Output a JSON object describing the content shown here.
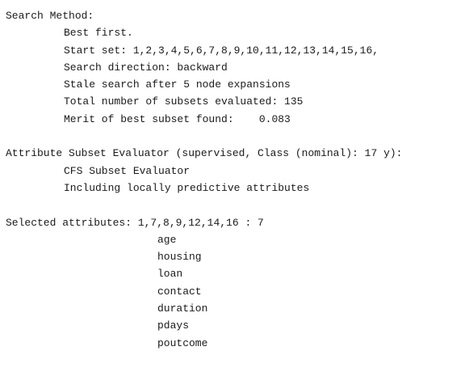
{
  "search": {
    "heading": "Search Method:",
    "method": "Best first.",
    "start_set": "Start set: 1,2,3,4,5,6,7,8,9,10,11,12,13,14,15,16,",
    "direction": "Search direction: backward",
    "stale": "Stale search after 5 node expansions",
    "subsets_evaluated": "Total number of subsets evaluated: 135",
    "merit": "Merit of best subset found:    0.083"
  },
  "evaluator": {
    "heading": "Attribute Subset Evaluator (supervised, Class (nominal): 17 y):",
    "name": "CFS Subset Evaluator",
    "option": "Including locally predictive attributes"
  },
  "selected": {
    "heading": "Selected attributes: 1,7,8,9,12,14,16 : 7",
    "attributes": [
      "age",
      "housing",
      "loan",
      "contact",
      "duration",
      "pdays",
      "poutcome"
    ]
  }
}
